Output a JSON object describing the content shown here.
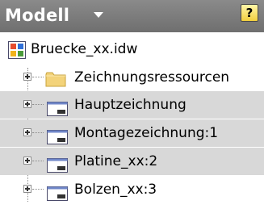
{
  "header": {
    "title": "Modell",
    "help": "?"
  },
  "tree": {
    "root": {
      "label": "Bruecke_xx.idw",
      "icon": "idw-file-icon"
    },
    "items": [
      {
        "label": "Zeichnungsressourcen",
        "icon": "folder-icon",
        "selected": false
      },
      {
        "label": "Hauptzeichnung",
        "icon": "sheet-icon",
        "selected": true
      },
      {
        "label": "Montagezeichnung:1",
        "icon": "sheet-icon",
        "selected": true
      },
      {
        "label": "Platine_xx:2",
        "icon": "sheet-icon",
        "selected": true
      },
      {
        "label": "Bolzen_xx:3",
        "icon": "sheet-icon",
        "selected": false
      }
    ]
  },
  "colors": {
    "header_bg": "#7d7d7d",
    "selection_bg": "#d8d8d8",
    "folder": "#f3d37a"
  }
}
